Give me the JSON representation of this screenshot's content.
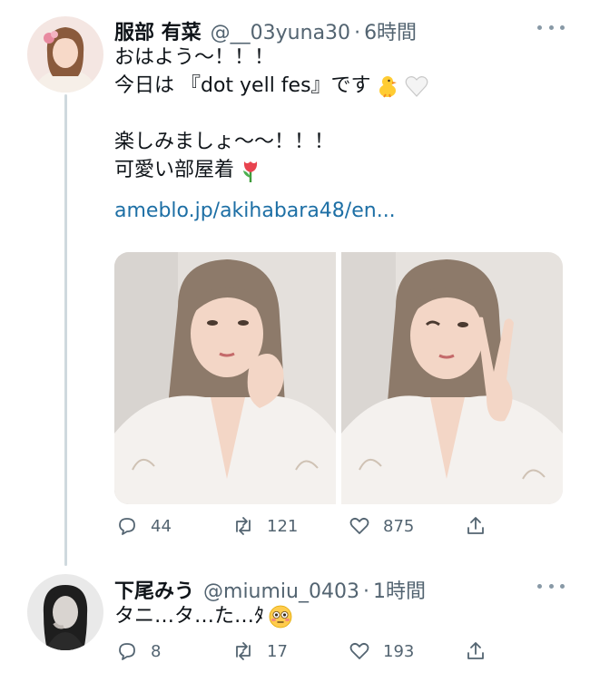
{
  "tweets": [
    {
      "name": "服部 有菜",
      "handle": "@__03yuna30",
      "separator": "·",
      "time": "6時間",
      "lines": [
        "おはよう〜！！！",
        "今日は 『dot yell fes』です",
        "",
        "楽しみましょ〜〜！！！",
        "可愛い部屋着"
      ],
      "link": "ameblo.jp/akihabara48/en...",
      "emojis": [
        "chick-emoji",
        "white-heart-emoji",
        "tulip-emoji"
      ],
      "reply_count": "44",
      "retweet_count": "121",
      "like_count": "875"
    },
    {
      "name": "下尾みう",
      "handle": "@miumiu_0403",
      "separator": "·",
      "time": "1時間",
      "text": "タニ…タ…た…ﾀ",
      "emojis": [
        "flushed-face-emoji"
      ],
      "reply_count": "8",
      "retweet_count": "17",
      "like_count": "193"
    }
  ],
  "colors": {
    "text": "#0f1419",
    "secondary": "#536471",
    "link": "#1d6fa5",
    "thread_line": "#cfd9de"
  }
}
